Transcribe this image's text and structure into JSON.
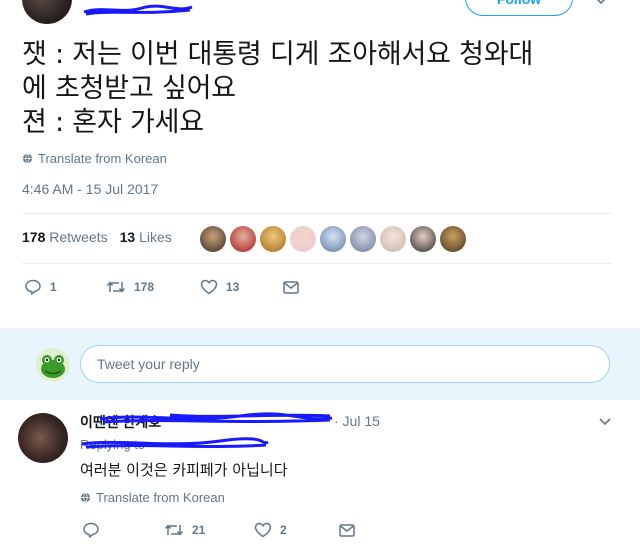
{
  "header": {
    "follow_label": "Follow"
  },
  "tweet": {
    "text_lines": [
      "잿 : 저는 이번 대통령 디게 조아해서요 청와대",
      "에 초청받고 싶어요",
      "젼 : 혼자 가세요"
    ],
    "translate_label": "Translate from Korean",
    "timestamp": "4:46 AM - 15 Jul 2017",
    "retweets_count": "178",
    "retweets_label": "Retweets",
    "likes_count": "13",
    "likes_label": "Likes",
    "actions": {
      "reply_count": "1",
      "retweet_count": "178",
      "like_count": "13"
    }
  },
  "reply_composer": {
    "placeholder": "Tweet your reply"
  },
  "reply": {
    "name": "이땐엔 한계호",
    "date": "· Jul 15",
    "replying_to": "Replying to",
    "text": "여러분 이것은 카피페가 아닙니다",
    "translate_label": "Translate from Korean",
    "actions": {
      "reply_count": "",
      "retweet_count": "21",
      "like_count": "2"
    }
  },
  "colors": {
    "accent": "#1da1f2",
    "muted": "#657786",
    "divider": "#e6ecf0",
    "redaction": "#1a1aff"
  }
}
